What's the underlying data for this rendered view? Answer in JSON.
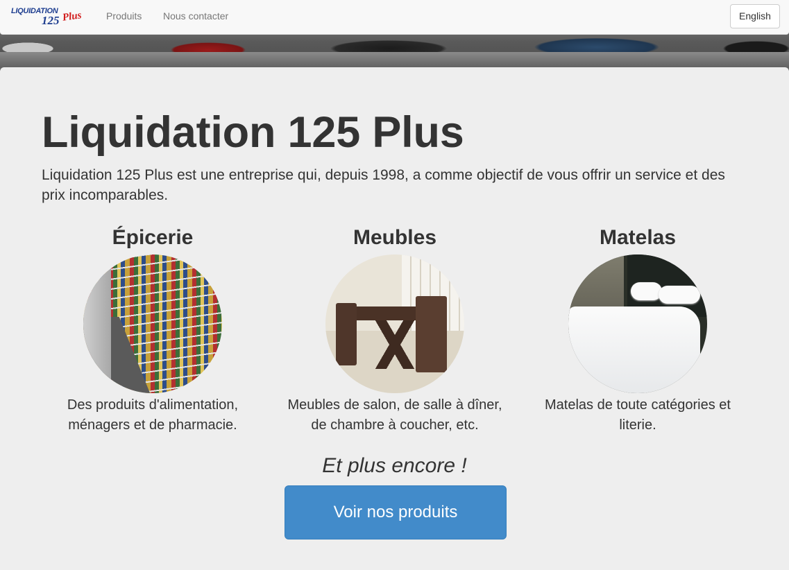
{
  "nav": {
    "logo_line1": "LIQUIDATION",
    "logo_line2": "125",
    "logo_line3": "Plus",
    "links": [
      "Produits",
      "Nous contacter"
    ],
    "language_button": "English"
  },
  "hero": {
    "title": "Liquidation 125 Plus",
    "intro": "Liquidation 125 Plus est une entreprise qui, depuis 1998, a comme objectif de vous offrir un service et des prix incomparables."
  },
  "categories": [
    {
      "title": "Épicerie",
      "description": "Des produits d'alimentation, ménagers et de pharmacie."
    },
    {
      "title": "Meubles",
      "description": "Meubles de salon, de salle à dîner, de chambre à coucher, etc."
    },
    {
      "title": "Matelas",
      "description": "Matelas de toute catégories et literie."
    }
  ],
  "more_text": "Et plus encore !",
  "cta_button": "Voir nos produits",
  "colors": {
    "primary": "#428bca",
    "jumbotron_bg": "#eeeeee",
    "navbar_bg": "#f8f8f8"
  }
}
